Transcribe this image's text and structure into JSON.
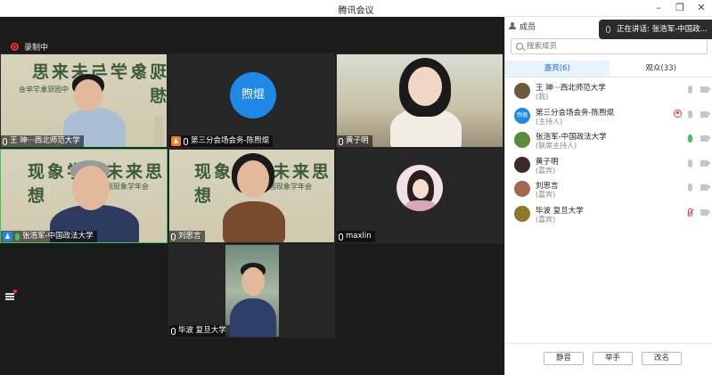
{
  "window": {
    "title": "腾讯会议"
  },
  "recording": {
    "label": "录制中"
  },
  "toast": {
    "text": "正在讲话: 张浩军-中国政..."
  },
  "tiles": [
    {
      "name": "王 珅···西北师范大学",
      "banner": "现象学与未来思想",
      "sub": "中国现象学年会"
    },
    {
      "name": "第三分会场会务-陈煦焜",
      "avatar_text": "煦焜"
    },
    {
      "name": "黄子明"
    },
    {
      "name": "张浩军-中国政法大学",
      "banner": "现象学与未来思想",
      "sub": "中国现象学年会"
    },
    {
      "name": "刘思言",
      "banner": "现象学与未来思想",
      "sub": "中国现象学年会"
    },
    {
      "name": "maxlin"
    },
    {
      "name": "毕波 复旦大学"
    }
  ],
  "panel": {
    "header": "成员",
    "search_placeholder": "搜索成员",
    "tabs": [
      {
        "label": "嘉宾(6)",
        "active": true
      },
      {
        "label": "观众(33)",
        "active": false
      }
    ],
    "members": [
      {
        "name": "王 珅···西北师范大学",
        "role": "(我)",
        "avatar_color": "#6b5a3e",
        "mic": "off"
      },
      {
        "name": "第三分会场会务-陈煦焜",
        "role": "(主持人)",
        "avatar_text": "煦焜",
        "avatar_color": "#1e88e5",
        "mic": "off",
        "recording": true
      },
      {
        "name": "张浩军-中国政法大学",
        "role": "(联席主持人)",
        "avatar_color": "#5a8a3a",
        "mic": "on"
      },
      {
        "name": "黄子明",
        "role": "(嘉宾)",
        "avatar_color": "#3a2a2a",
        "mic": "off"
      },
      {
        "name": "刘思言",
        "role": "(嘉宾)",
        "avatar_color": "#a06a50",
        "mic": "off"
      },
      {
        "name": "毕波 复旦大学",
        "role": "(嘉宾)",
        "avatar_color": "#8a7a2a",
        "mic": "muted"
      }
    ],
    "buttons": {
      "mute": "静音",
      "raise_hand": "举手",
      "rename": "改名"
    }
  },
  "colors": {
    "accent": "#1e88e5",
    "active_speaker": "#3fc35f",
    "recording": "#e33333",
    "video_bg": "#1b1b1b"
  }
}
